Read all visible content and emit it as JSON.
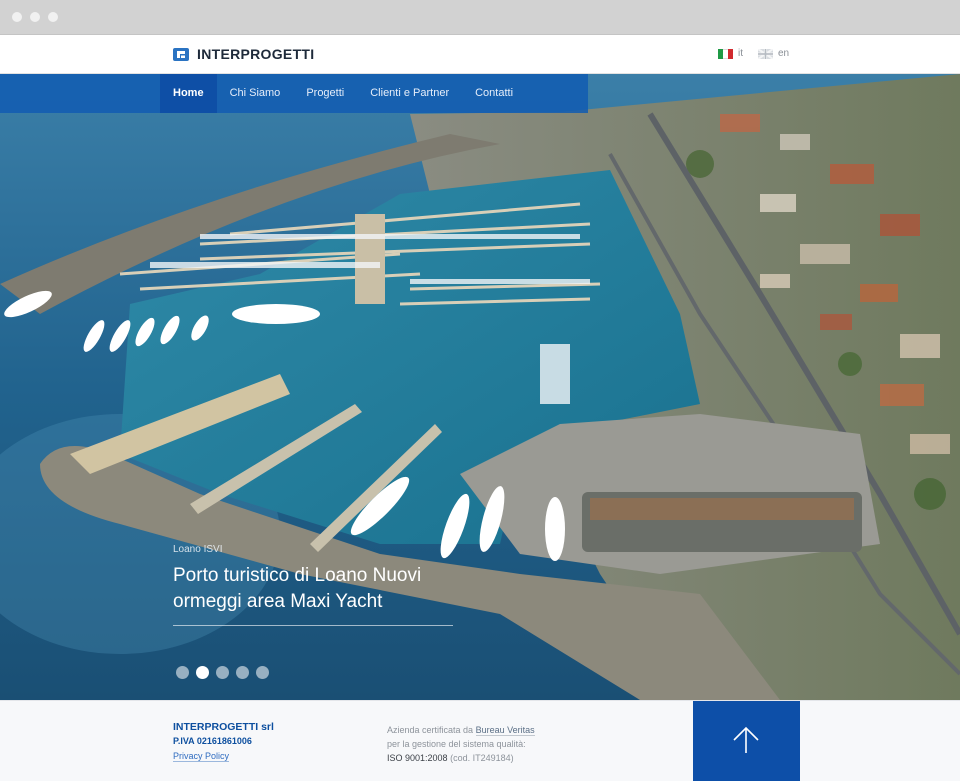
{
  "header": {
    "brand": "INTERPROGETTI",
    "languages": [
      {
        "code": "it",
        "flag": "italy-flag-icon"
      },
      {
        "code": "en",
        "flag": "uk-flag-icon"
      }
    ]
  },
  "nav": {
    "items": [
      {
        "label": "Home",
        "active": true
      },
      {
        "label": "Chi Siamo"
      },
      {
        "label": "Progetti"
      },
      {
        "label": "Clienti e Partner"
      },
      {
        "label": "Contatti"
      }
    ]
  },
  "hero": {
    "kicker": "Loano ISVI",
    "headline": "Porto turistico di Loano Nuovi ormeggi area Maxi Yacht",
    "slides_count": 5,
    "active_slide": 2
  },
  "footer": {
    "company": "INTERPROGETTI srl",
    "piva": "P.IVA 02161861006",
    "privacy": "Privacy Policy",
    "cert_prefix": "Azienda certificata da",
    "cert_body": "Bureau Veritas",
    "cert_line2": "per la gestione del sistema qualità:",
    "iso": "ISO 9001:2008",
    "iso_code": "(cod. IT249184)",
    "to_top_icon": "arrow-up-icon"
  },
  "colors": {
    "nav_bg": "#125cb2",
    "nav_active": "#0e4fa6",
    "brand_blue": "#0d4f9f",
    "to_top": "#0d4fa8"
  }
}
